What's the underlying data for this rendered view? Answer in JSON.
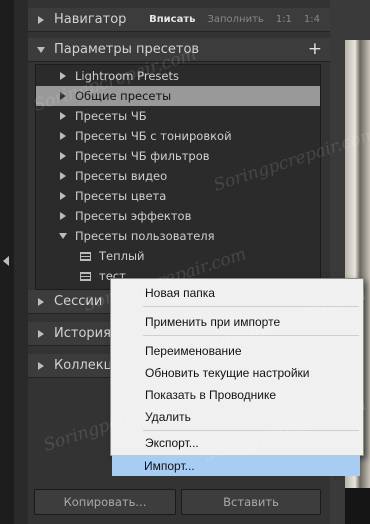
{
  "navigator": {
    "title": "Навигатор",
    "options": [
      "Вписать",
      "Заполнить",
      "1:1",
      "1:4"
    ],
    "selected_option": "Вписать"
  },
  "presets": {
    "title": "Параметры пресетов",
    "add_icon": "plus-icon",
    "items": [
      {
        "label": "Lightroom Presets"
      },
      {
        "label": "Общие пресеты"
      },
      {
        "label": "Пресеты ЧБ"
      },
      {
        "label": "Пресеты ЧБ с тонировкой"
      },
      {
        "label": "Пресеты ЧБ фильтров"
      },
      {
        "label": "Пресеты видео"
      },
      {
        "label": "Пресеты цвета"
      },
      {
        "label": "Пресеты эффектов"
      },
      {
        "label": "Пресеты пользователя"
      }
    ],
    "user_presets": [
      {
        "label": "Теплый"
      },
      {
        "label": "тест"
      }
    ]
  },
  "sections": [
    "Сессии",
    "История",
    "Коллекции"
  ],
  "buttons": {
    "copy": "Копировать...",
    "paste": "Вставить"
  },
  "context_menu": {
    "items": [
      "Новая папка",
      "Применить при импорте",
      "Переименование",
      "Обновить текущие настройки",
      "Показать в Проводнике",
      "Удалить",
      "Экспорт...",
      "Импорт..."
    ],
    "highlighted": "Импорт..."
  },
  "watermark": "Soringpcrepair.com",
  "colors": {
    "panel": "#333333",
    "selection": "#999999",
    "menu_highlight": "#a8cdf2"
  }
}
